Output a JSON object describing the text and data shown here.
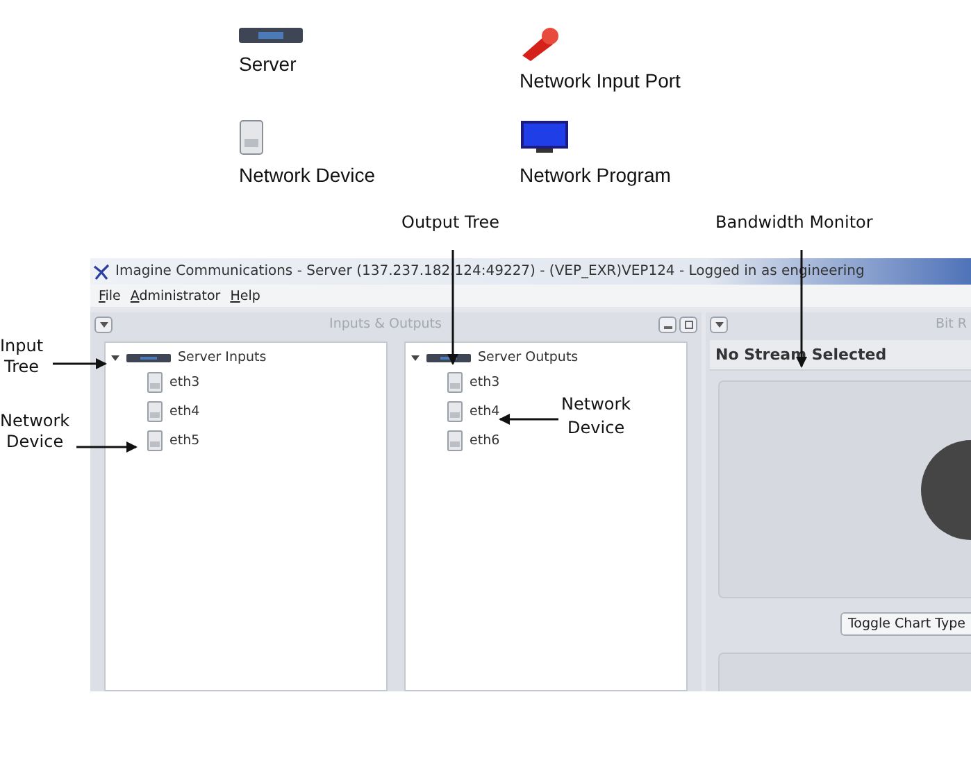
{
  "legend": [
    {
      "kind": "server",
      "label": "Server"
    },
    {
      "kind": "port",
      "label": "Network Input Port"
    },
    {
      "kind": "device",
      "label": "Network Device"
    },
    {
      "kind": "program",
      "label": "Network Program"
    }
  ],
  "callouts": {
    "output_tree": "Output Tree",
    "bandwidth_monitor": "Bandwidth Monitor",
    "input_tree": "Input\nTree",
    "device_left": "Network\nDevice",
    "device_middle": "Network\nDevice"
  },
  "window": {
    "title": "Imagine Communications - Server (137.237.182.124:49227) - (VEP_EXR)VEP124 - Logged in as engineering",
    "menu": [
      "File",
      "Administrator",
      "Help"
    ],
    "left_pane": {
      "title": "Inputs & Outputs",
      "trees": [
        {
          "label": "Server Inputs",
          "expanded": true,
          "children": [
            {
              "label": "eth3"
            },
            {
              "label": "eth4"
            },
            {
              "label": "eth5"
            }
          ]
        },
        {
          "label": "Server Outputs",
          "expanded": true,
          "children": [
            {
              "label": "eth3"
            },
            {
              "label": "eth4"
            },
            {
              "label": "eth6"
            }
          ]
        }
      ]
    },
    "right_pane": {
      "title": "Bit R",
      "stream": "No Stream Selected",
      "toggle_button": "Toggle Chart Type"
    }
  }
}
